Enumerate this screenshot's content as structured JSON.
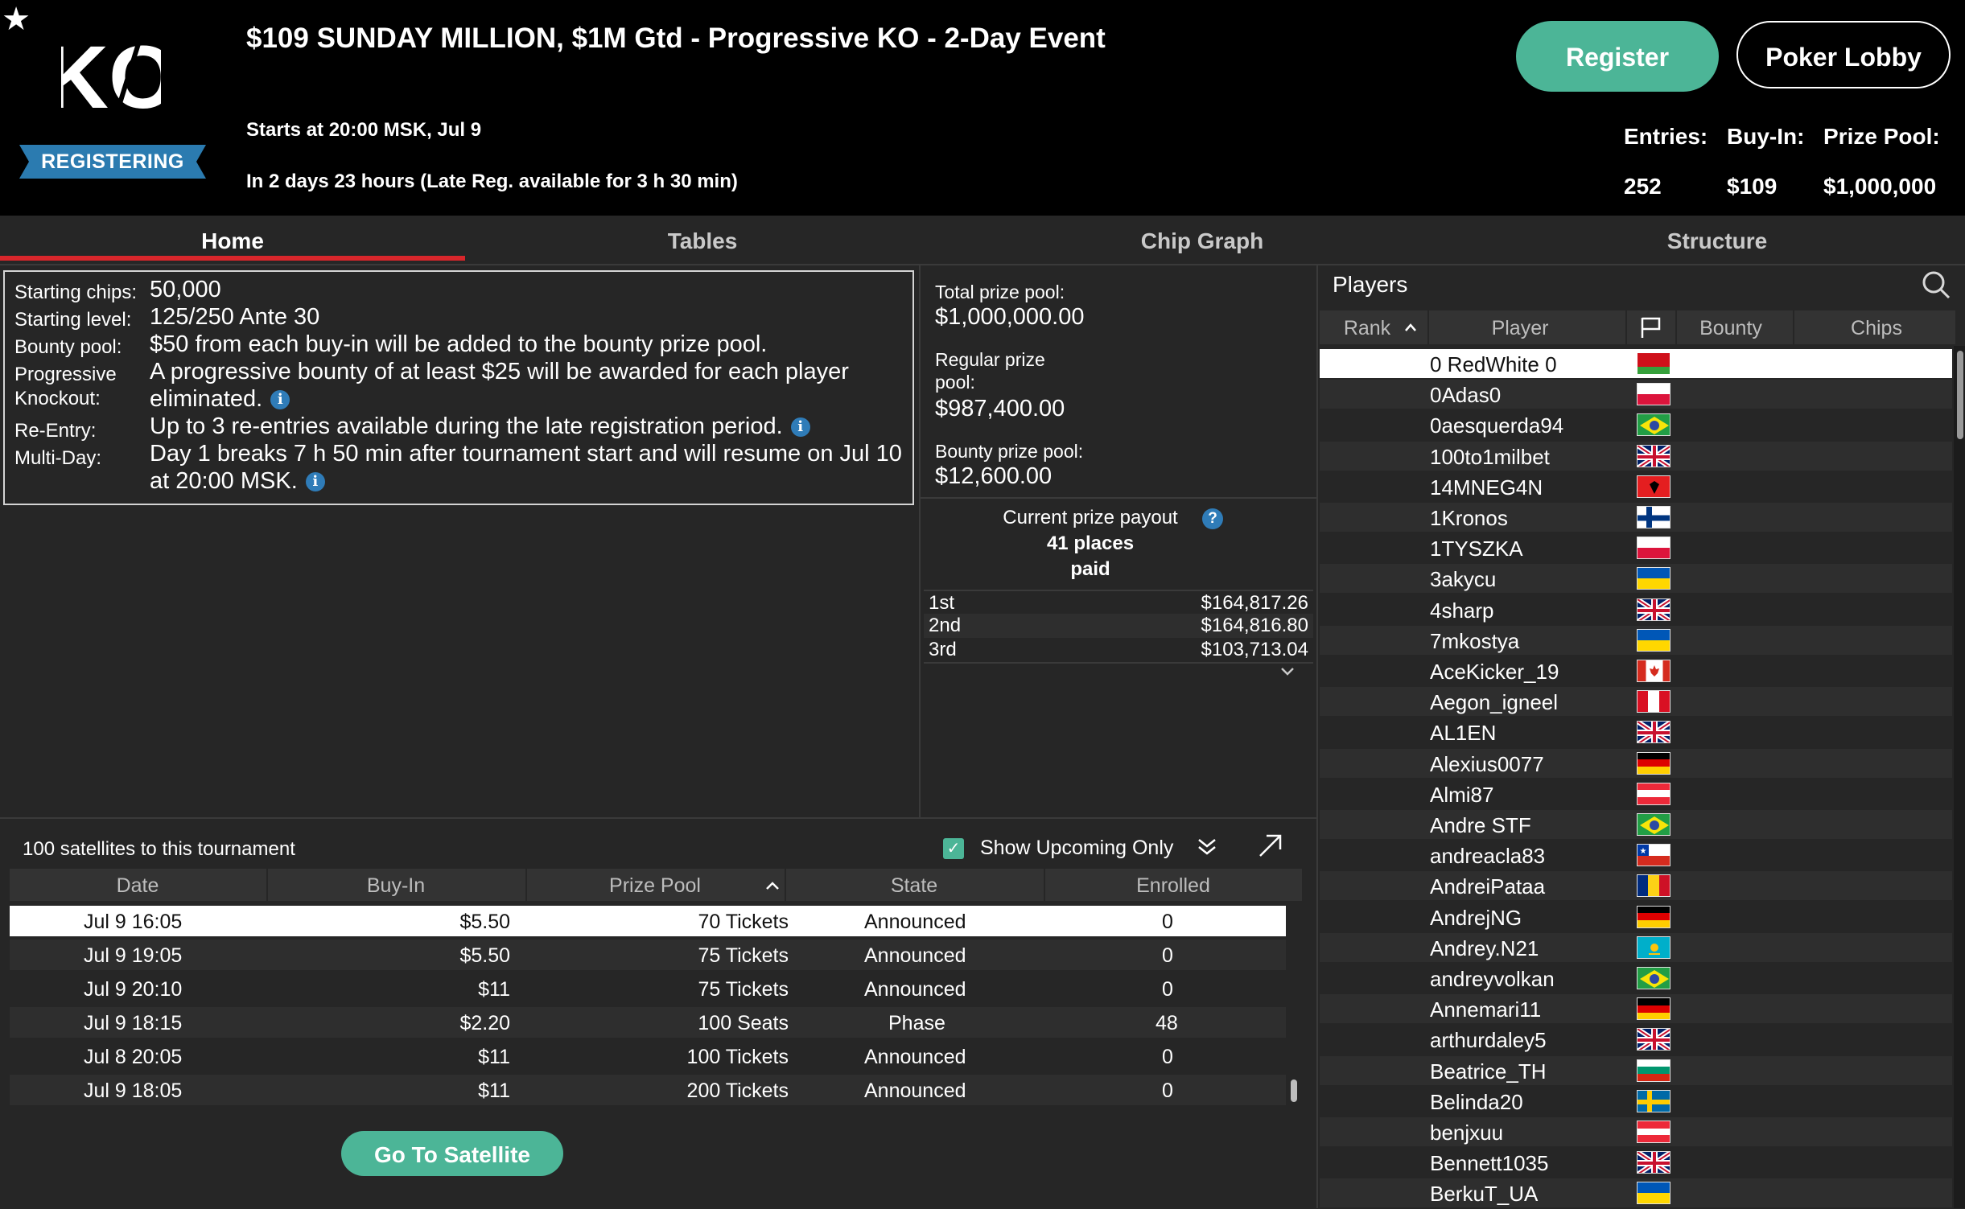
{
  "header": {
    "logo_text": "KO",
    "status_badge": "REGISTERING",
    "title": "$109 SUNDAY MILLION, $1M Gtd - Progressive KO - 2-Day Event",
    "start_text": "Starts at 20:00 MSK, Jul 9",
    "countdown_text": "In 2 days 23 hours (Late Reg. available for 3 h 30 min)",
    "register_label": "Register",
    "lobby_label": "Poker Lobby",
    "entries_label": "Entries:",
    "entries_value": "252",
    "buyin_label": "Buy-In:",
    "buyin_value": "$109",
    "prizepool_label": "Prize Pool:",
    "prizepool_value": "$1,000,000"
  },
  "tabs": [
    "Home",
    "Tables",
    "Chip Graph",
    "Structure"
  ],
  "active_tab": "Home",
  "info": {
    "starting_chips_label": "Starting chips:",
    "starting_chips": "50,000",
    "starting_level_label": "Starting level:",
    "starting_level": "125/250 Ante 30",
    "bounty_pool_label": "Bounty pool:",
    "bounty_pool": "$50 from each buy-in will be added to the bounty prize pool.",
    "progressive_label_1": "Progressive",
    "progressive_label_2": "Knockout:",
    "progressive_1": "A progressive bounty of at least $25 will be awarded for each player",
    "progressive_2": "eliminated.",
    "reentry_label": "Re-Entry:",
    "reentry": "Up to 3 re-entries available during the late registration period.",
    "multiday_label": "Multi-Day:",
    "multiday_1": "Day 1 breaks 7 h 50 min after tournament start and will resume on Jul 10",
    "multiday_2": "at 20:00 MSK."
  },
  "prize": {
    "total_label": "Total prize pool:",
    "total_value": "$1,000,000.00",
    "regular_label_1": "Regular prize",
    "regular_label_2": "pool:",
    "regular_value": "$987,400.00",
    "bounty_label": "Bounty prize pool:",
    "bounty_value": "$12,600.00",
    "payout_line1": "Current prize payout",
    "payout_line2": "41 places",
    "payout_line3": "paid",
    "payouts": [
      {
        "place": "1st",
        "amount": "$164,817.26"
      },
      {
        "place": "2nd",
        "amount": "$164,816.80"
      },
      {
        "place": "3rd",
        "amount": "$103,713.04"
      }
    ]
  },
  "satellites": {
    "title": "100 satellites to this tournament",
    "show_upcoming_label": "Show Upcoming Only",
    "show_upcoming_checked": true,
    "columns": [
      "Date",
      "Buy-In",
      "Prize Pool",
      "State",
      "Enrolled"
    ],
    "sorted_column": "Prize Pool",
    "rows": [
      {
        "date": "Jul 9  16:05",
        "buyin": "$5.50",
        "prize": "70 Tickets",
        "state": "Announced",
        "enrolled": "0"
      },
      {
        "date": "Jul 9  19:05",
        "buyin": "$5.50",
        "prize": "75 Tickets",
        "state": "Announced",
        "enrolled": "0"
      },
      {
        "date": "Jul 9  20:10",
        "buyin": "$11",
        "prize": "75 Tickets",
        "state": "Announced",
        "enrolled": "0"
      },
      {
        "date": "Jul 9  18:15",
        "buyin": "$2.20",
        "prize": "100 Seats",
        "state": "Phase",
        "enrolled": "48"
      },
      {
        "date": "Jul 8  20:05",
        "buyin": "$11",
        "prize": "100 Tickets",
        "state": "Announced",
        "enrolled": "0"
      },
      {
        "date": "Jul 9  18:05",
        "buyin": "$11",
        "prize": "200 Tickets",
        "state": "Announced",
        "enrolled": "0"
      }
    ],
    "go_button_label": "Go To Satellite"
  },
  "players": {
    "title": "Players",
    "columns": [
      "Rank",
      "Player",
      "Bounty",
      "Chips"
    ],
    "rows": [
      {
        "name": "0 RedWhite 0",
        "flag": "belarus"
      },
      {
        "name": "0Adas0",
        "flag": "poland"
      },
      {
        "name": "0aesquerda94",
        "flag": "brazil"
      },
      {
        "name": "100to1milbet",
        "flag": "uk"
      },
      {
        "name": "14MNEG4N",
        "flag": "albania"
      },
      {
        "name": "1Kronos",
        "flag": "finland"
      },
      {
        "name": "1TYSZKA",
        "flag": "poland"
      },
      {
        "name": "3akycu",
        "flag": "ukraine"
      },
      {
        "name": "4sharp",
        "flag": "uk"
      },
      {
        "name": "7mkostya",
        "flag": "ukraine"
      },
      {
        "name": "AceKicker_19",
        "flag": "canada"
      },
      {
        "name": "Aegon_igneel",
        "flag": "peru"
      },
      {
        "name": "AL1EN",
        "flag": "uk"
      },
      {
        "name": "Alexius0077",
        "flag": "germany"
      },
      {
        "name": "Almi87",
        "flag": "austria"
      },
      {
        "name": "Andre STF",
        "flag": "brazil"
      },
      {
        "name": "andreacla83",
        "flag": "chile"
      },
      {
        "name": "AndreiPataa",
        "flag": "romania"
      },
      {
        "name": "AndrejNG",
        "flag": "germany"
      },
      {
        "name": "Andrey.N21",
        "flag": "kazakhstan"
      },
      {
        "name": "andreyvolkan",
        "flag": "brazil"
      },
      {
        "name": "Annemari11",
        "flag": "germany"
      },
      {
        "name": "arthurdaley5",
        "flag": "uk"
      },
      {
        "name": "Beatrice_TH",
        "flag": "bulgaria"
      },
      {
        "name": "Belinda20",
        "flag": "sweden"
      },
      {
        "name": "benjxuu",
        "flag": "austria"
      },
      {
        "name": "Bennett1035",
        "flag": "uk"
      },
      {
        "name": "BerkuT_UA",
        "flag": "ukraine"
      }
    ]
  },
  "colors": {
    "accent_green": "#4cb597",
    "tab_underline": "#d8262b",
    "ribbon_blue": "#2b7bb0",
    "background": "#262626"
  }
}
